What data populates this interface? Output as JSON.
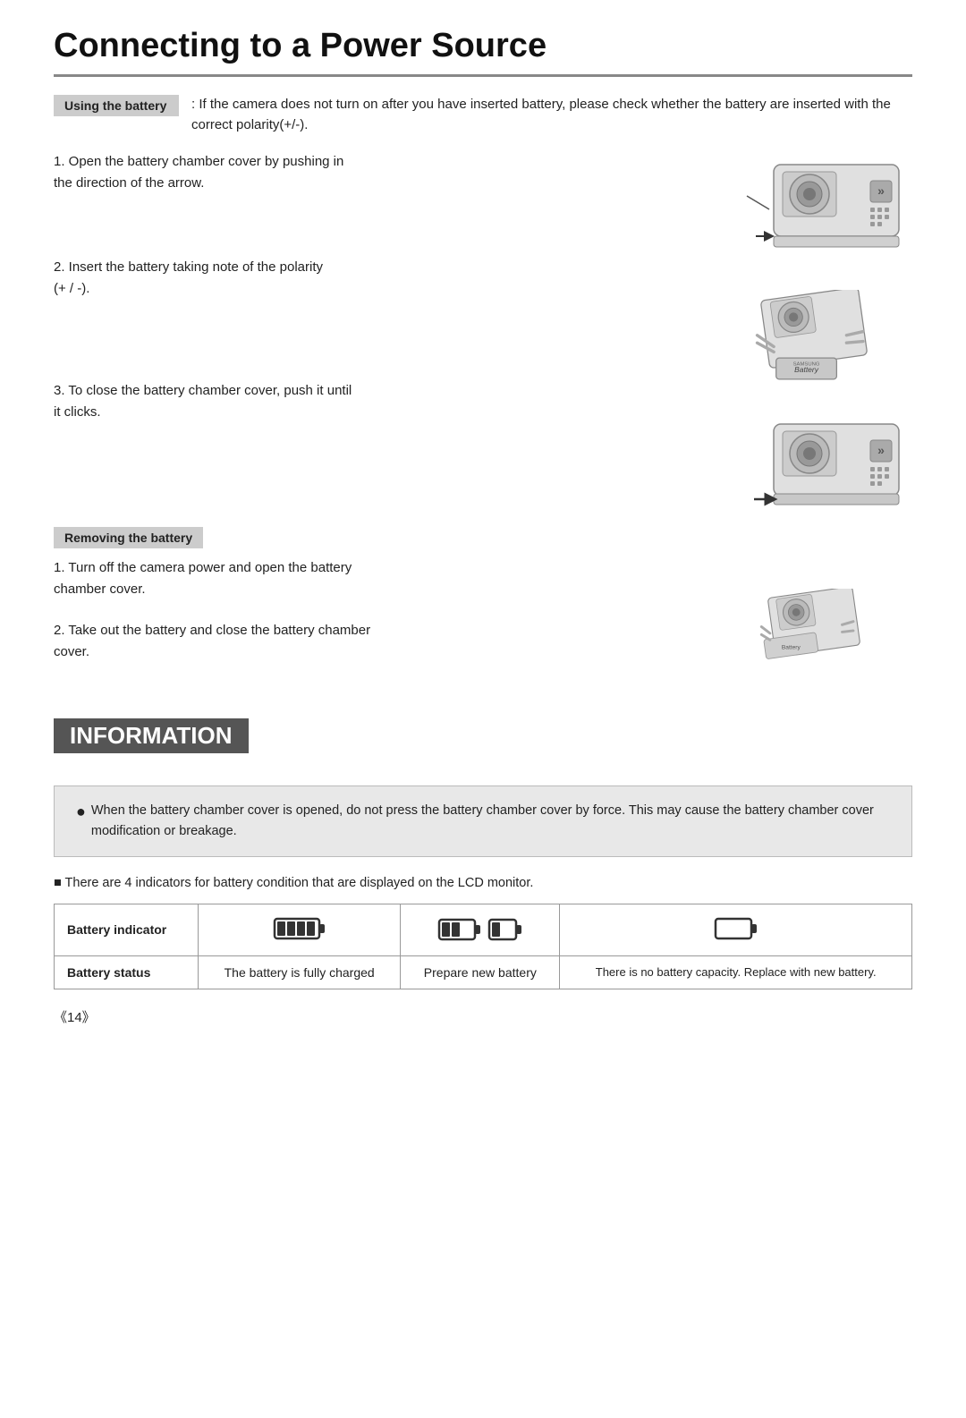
{
  "page": {
    "title": "Connecting to a Power Source",
    "page_number": "《14》"
  },
  "using_battery": {
    "label": "Using the battery",
    "intro_text": ": If the camera does not turn on after you have inserted battery, please check whether the battery are inserted with the correct polarity(+/-).",
    "steps": [
      {
        "number": "1",
        "text": "Open the battery chamber cover by pushing in the direction of the arrow."
      },
      {
        "number": "2",
        "text": "Insert the battery taking note of the polarity (+ / -)."
      },
      {
        "number": "3",
        "text": "To close the battery chamber cover, push it until it clicks."
      }
    ]
  },
  "removing_battery": {
    "label": "Removing the battery",
    "steps": [
      {
        "number": "1",
        "text": "Turn off the camera power and open the battery chamber cover."
      },
      {
        "number": "2",
        "text": "Take out the battery and close the battery chamber cover."
      }
    ]
  },
  "information": {
    "title": "INFORMATION",
    "bullet": "When the battery chamber cover is opened, do not press the battery chamber cover by force. This may cause the battery chamber cover modification or breakage."
  },
  "battery_note": "■  There are 4 indicators for battery condition that are displayed on the LCD monitor.",
  "battery_table": {
    "headers": [
      "Battery indicator",
      "icon_full",
      "icon_medium",
      "icon_low",
      "icon_empty"
    ],
    "row_label": "Battery status",
    "status_full": "The battery is fully charged",
    "status_medium": "Prepare new battery",
    "status_empty": "There is no battery capacity. Replace with new battery."
  }
}
